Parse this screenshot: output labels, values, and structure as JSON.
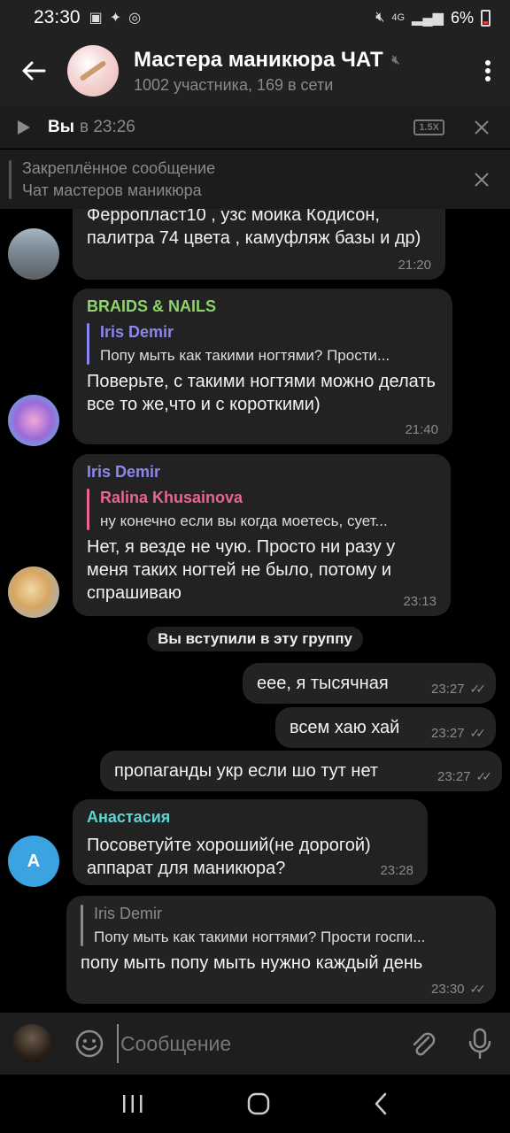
{
  "status_bar": {
    "time": "23:30",
    "network": "4G",
    "battery": "6%"
  },
  "header": {
    "title": "Мастера маникюра ЧАТ",
    "subtitle": "1002 участника, 169 в сети"
  },
  "player": {
    "who": "Вы",
    "time": "в 23:26",
    "speed": "1.5X"
  },
  "pinned": {
    "title": "Закреплённое сообщение",
    "text": "Чат мастеров маникюра"
  },
  "messages": [
    {
      "text": "Ферропласт10 , узс моика Кодисон, палитра 74 цвета , камуфляж базы и др)",
      "time": "21:20"
    },
    {
      "sender": "BRAIDS & NAILS",
      "sender_color": "#8fd36b",
      "reply_name": "Iris Demir",
      "reply_color": "#8c86ef",
      "reply_text": "Попу мыть как такими ногтями? Прости...",
      "text": "Поверьте, с такими ногтями можно делать все то же,что и с короткими)",
      "time": "21:40"
    },
    {
      "sender": "Iris Demir",
      "sender_color": "#8c86ef",
      "reply_name": "Ralina Khusainova",
      "reply_color": "#e8668d",
      "reply_text": "ну конечно если вы когда моетесь, сует...",
      "text": "Нет, я везде не чую. Просто ни разу у меня таких ногтей не было, потому и спрашиваю",
      "time": "23:13"
    },
    {
      "system": "Вы вступили в эту группу"
    },
    {
      "text": "еее, я тысячная",
      "time": "23:27"
    },
    {
      "text": "всем хаю хай",
      "time": "23:27"
    },
    {
      "text": "пропаганды укр если шо тут нет",
      "time": "23:27"
    },
    {
      "sender": "Анастасия",
      "sender_color": "#5ed4d0",
      "avatar_letter": "А",
      "avatar_color": "#3aa3e0",
      "text": "Посоветуйте хороший(не дорогой) аппарат для маникюра?",
      "time": "23:28"
    },
    {
      "reply_name": "Iris Demir",
      "reply_color": "#8a8a8a",
      "reply_text": "Попу мыть как такими ногтями? Прости госпи...",
      "text": "попу мыть попу мыть нужно каждый день",
      "time": "23:30"
    }
  ],
  "input": {
    "placeholder": "Сообщение"
  },
  "icons": {
    "back": "arrow-left",
    "menu": "more-vertical",
    "play": "play",
    "close": "close",
    "emoji": "smile",
    "attach": "paperclip",
    "mic": "microphone",
    "nav_recent": "recent-apps",
    "nav_home": "home",
    "nav_back": "back"
  }
}
